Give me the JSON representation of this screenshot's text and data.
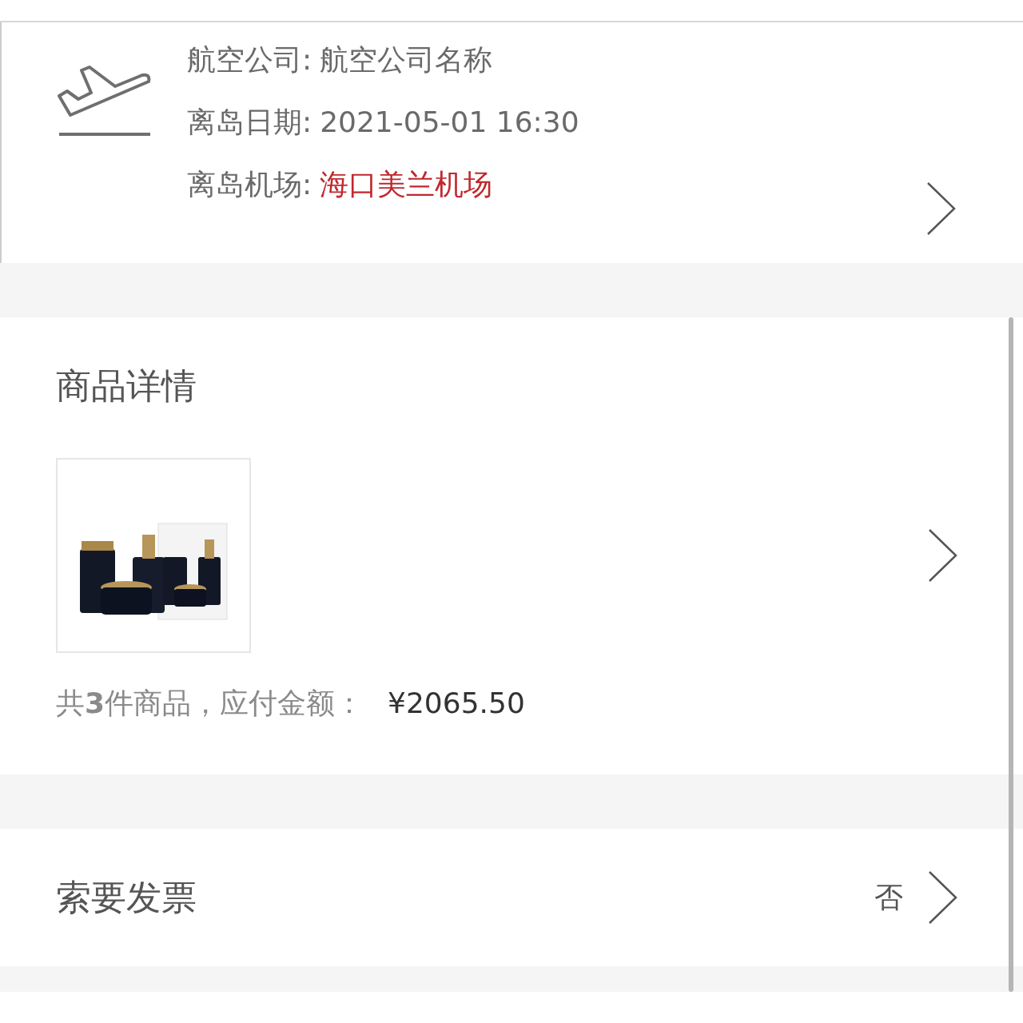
{
  "flight": {
    "rows": [
      {
        "label": "航空公司:",
        "value": "航空公司名称",
        "highlight": false
      },
      {
        "label": "离岛日期:",
        "value": "2021-05-01 16:30",
        "highlight": false
      },
      {
        "label": "离岛机场:",
        "value": "海口美兰机场",
        "highlight": true
      }
    ]
  },
  "goods": {
    "title": "商品详情",
    "summary": "共**3**件商品，应付金额：",
    "total": "¥2065.50"
  },
  "invoice": {
    "label": "索要发票",
    "value": "否"
  }
}
